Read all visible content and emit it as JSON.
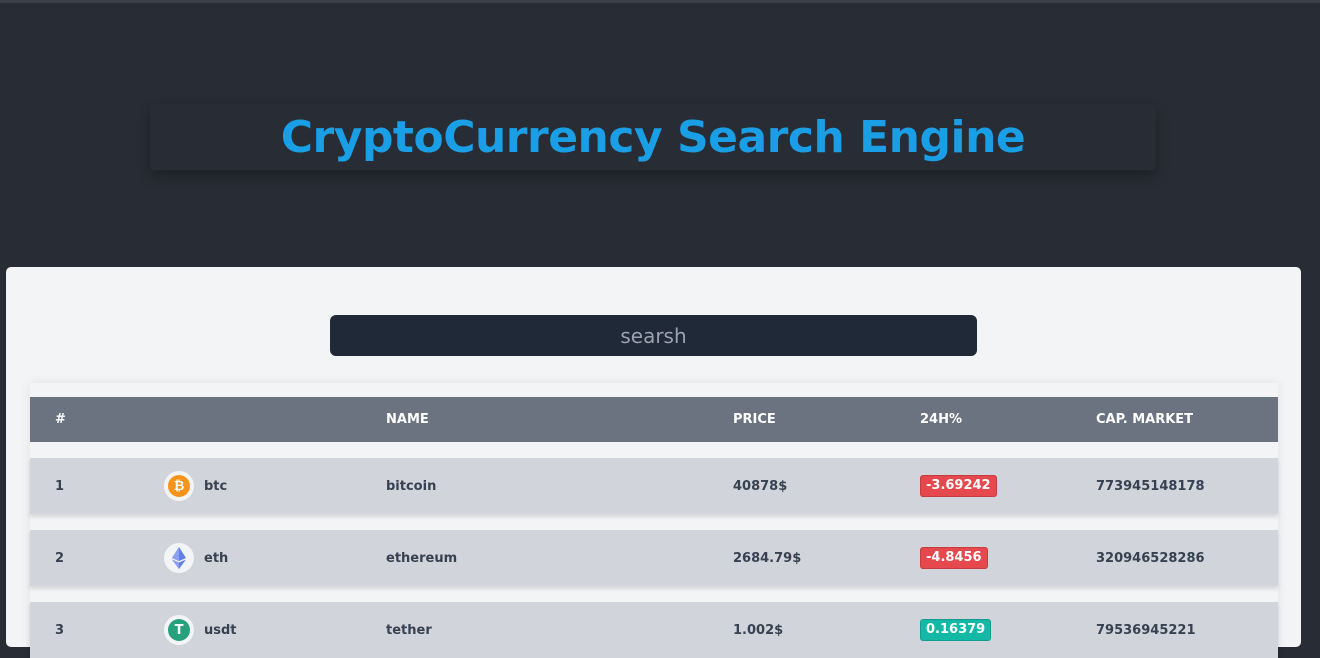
{
  "header": {
    "title": "CryptoCurrency Search Engine"
  },
  "search": {
    "placeholder": "searsh"
  },
  "table": {
    "columns": [
      "#",
      "",
      "NAME",
      "PRICE",
      "24H%",
      "CAP. MARKET"
    ],
    "rows": [
      {
        "rank": "1",
        "symbol": "btc",
        "name": "bitcoin",
        "price": "40878$",
        "change": "-3.69242",
        "change_color": "#e5484d",
        "cap": "773945148178",
        "icon": "bitcoin-icon",
        "icon_color": "#f7931a",
        "icon_glyph": "₿"
      },
      {
        "rank": "2",
        "symbol": "eth",
        "name": "ethereum",
        "price": "2684.79$",
        "change": "-4.8456",
        "change_color": "#e5484d",
        "cap": "320946528286",
        "icon": "ethereum-icon",
        "icon_color": "#627eea",
        "icon_glyph": "◆"
      },
      {
        "rank": "3",
        "symbol": "usdt",
        "name": "tether",
        "price": "1.002$",
        "change": "0.16379",
        "change_color": "#14b8a6",
        "cap": "79536945221",
        "icon": "tether-icon",
        "icon_color": "#26a17b",
        "icon_glyph": "T"
      }
    ]
  },
  "colors": {
    "background": "#282c34",
    "title": "#1a9ee6",
    "panel": "#f3f4f6",
    "table_header": "#6b7280",
    "row": "#d1d5db",
    "negative": "#e5484d",
    "positive": "#14b8a6"
  }
}
